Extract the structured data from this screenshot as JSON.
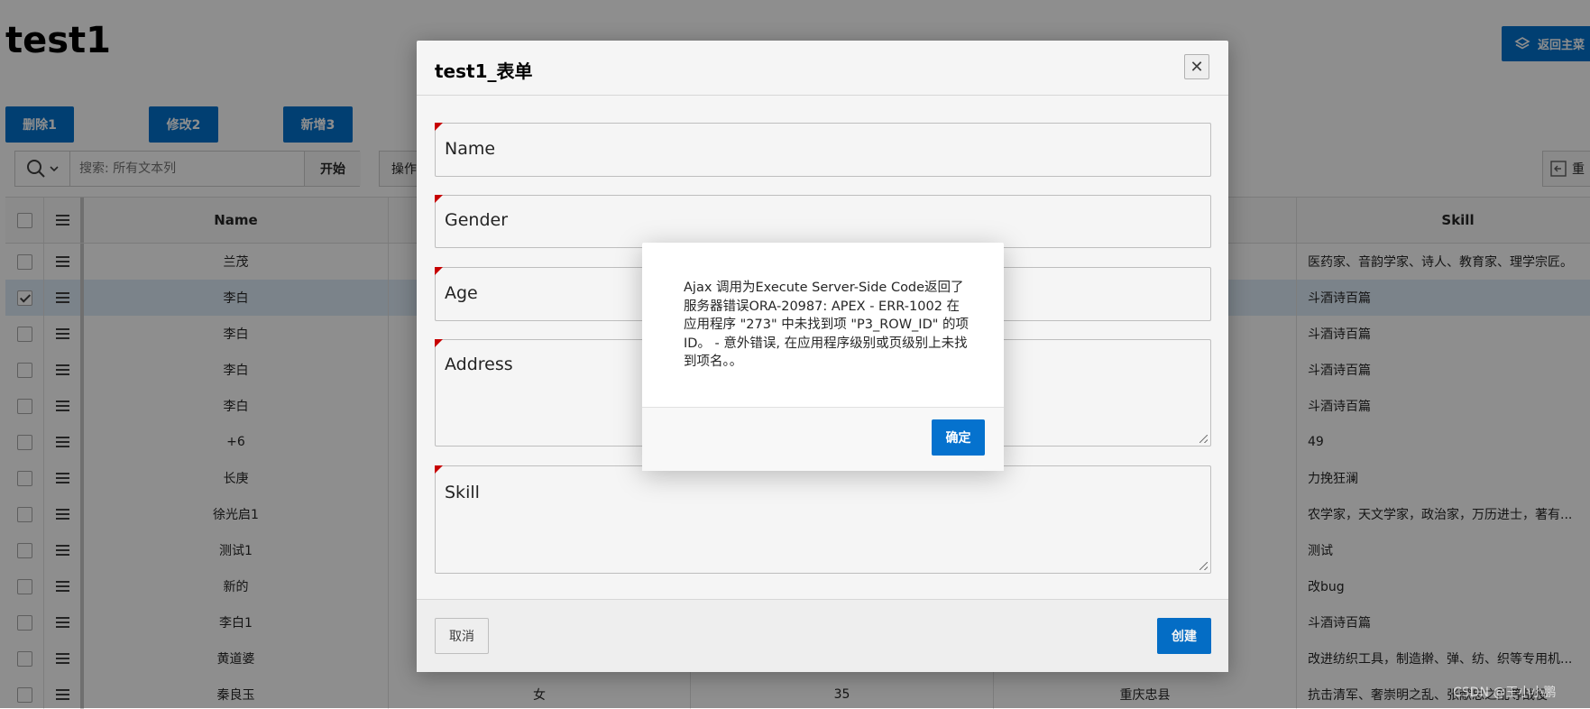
{
  "page": {
    "title": "test1",
    "back_button_label": "返回主菜",
    "toolbar": [
      "删除1",
      "修改2",
      "新增3"
    ],
    "search": {
      "placeholder": "搜索: 所有文本列",
      "go_label": "开始"
    },
    "actions_label": "操作",
    "reset_label": "重"
  },
  "grid": {
    "columns": {
      "name": "Name",
      "skill": "Skill"
    },
    "rows": [
      {
        "name": "兰茂",
        "gender": "",
        "age": "",
        "address": "",
        "skill": "医药家、音韵学家、诗人、教育家、理学宗匠。",
        "selected": false
      },
      {
        "name": "李白",
        "gender": "",
        "age": "",
        "address": "",
        "skill": "斗酒诗百篇",
        "selected": true
      },
      {
        "name": "李白",
        "gender": "",
        "age": "",
        "address": "",
        "skill": "斗酒诗百篇",
        "selected": false
      },
      {
        "name": "李白",
        "gender": "",
        "age": "",
        "address": "",
        "skill": "斗酒诗百篇",
        "selected": false
      },
      {
        "name": "李白",
        "gender": "",
        "age": "",
        "address": "",
        "skill": "斗酒诗百篇",
        "selected": false
      },
      {
        "name": "+6",
        "gender": "",
        "age": "",
        "address": "",
        "skill": "49",
        "selected": false
      },
      {
        "name": "长庚",
        "gender": "",
        "age": "",
        "address": "",
        "skill": "力挽狂澜",
        "selected": false
      },
      {
        "name": "徐光启1",
        "gender": "",
        "age": "",
        "address": "",
        "skill": "农学家，天文学家，政治家，万历进士，著有...",
        "selected": false
      },
      {
        "name": "测试1",
        "gender": "",
        "age": "",
        "address": "",
        "skill": "测试",
        "selected": false
      },
      {
        "name": "新的",
        "gender": "",
        "age": "",
        "address": "",
        "skill": "改bug",
        "selected": false
      },
      {
        "name": "李白1",
        "gender": "",
        "age": "",
        "address": "",
        "skill": "斗酒诗百篇",
        "selected": false
      },
      {
        "name": "黄道婆",
        "gender": "",
        "age": "",
        "address": "",
        "skill": "改进纺织工具，制造擀、弹、纺、织等专用机...",
        "selected": false
      },
      {
        "name": "秦良玉",
        "gender": "女",
        "age": "35",
        "address": "重庆忠县",
        "skill": "抗击清军、奢崇明之乱、张献忠之乱等战役",
        "selected": false
      }
    ]
  },
  "dialog": {
    "title": "test1_表单",
    "fields": [
      "Name",
      "Gender",
      "Age",
      "Address",
      "Skill"
    ],
    "cancel_label": "取消",
    "create_label": "创建"
  },
  "alert": {
    "message": "Ajax 调用为Execute Server-Side Code返回了服务器错误ORA-20987: APEX - ERR-1002 在应用程序 \"273\" 中未找到项 \"P3_ROW_ID\" 的项 ID。 - 意外错误, 在应用程序级别或页级别上未找到项名。。",
    "ok_label": "确定"
  },
  "watermark": "CSDN @王小小鹏",
  "colors": {
    "primary": "#0572ce",
    "required_marker": "#d00000"
  }
}
